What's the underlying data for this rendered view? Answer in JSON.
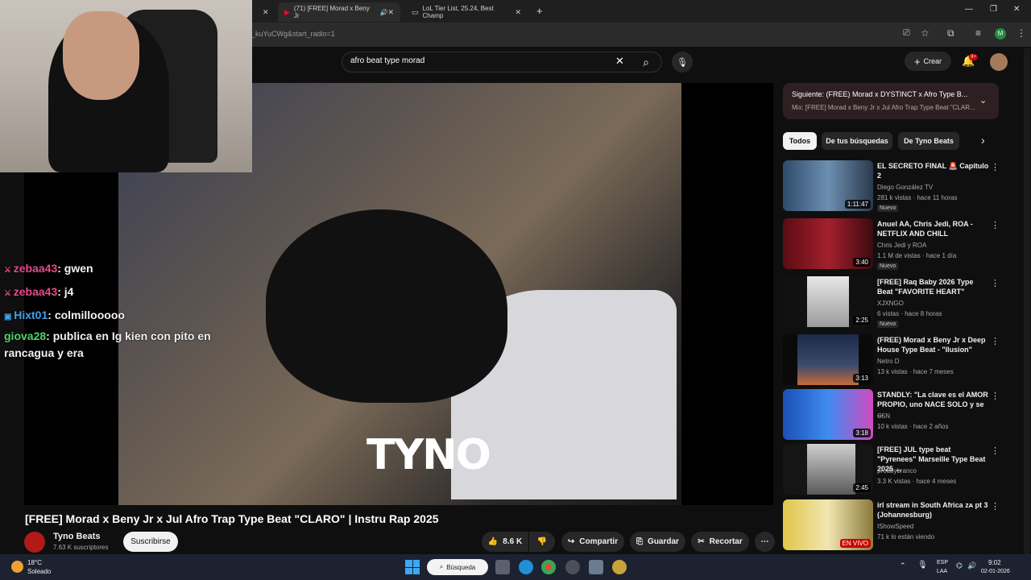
{
  "browser": {
    "tabs": [
      {
        "label": "(71) [FREE] Morad x Beny Jr"
      },
      {
        "label": "LoL Tier List, 25.24, Best Champ"
      }
    ],
    "new_tab": "+",
    "url": "_kuYuCWg&start_radio=1"
  },
  "header": {
    "search_query": "afro beat type morad",
    "create_label": "Crear",
    "notif_count": "9+"
  },
  "video": {
    "watermark": "TYNO",
    "title": "[FREE] Morad x Beny Jr x Jul Afro Trap Type Beat \"CLARO\" | Instru Rap 2025",
    "channel": "Tyno Beats",
    "subscribers": "7.63 K suscriptores",
    "subscribe_label": "Suscribirse",
    "likes": "8.6 K",
    "share_label": "Compartir",
    "save_label": "Guardar",
    "clip_label": "Recortar"
  },
  "chat": [
    {
      "user": "zebaa43",
      "text": ": gwen",
      "color": "#e54b8a"
    },
    {
      "user": "zebaa43",
      "text": ": j4",
      "color": "#e54b8a"
    },
    {
      "user": "Hixt01",
      "text": ": colmillooooo",
      "color": "#3fa3e8"
    },
    {
      "user": "giova28",
      "text": ": publica en Ig kien con pito en rancagua y era",
      "color": "#4fd36a"
    }
  ],
  "sidebar": {
    "next_title": "Siguiente: (FREE) Morad x DYSTINCT x Afro Type B...",
    "next_sub": "Mix: [FREE] Morad x Beny Jr x Jul Afro Trap Type Beat \"CLAR...",
    "chips": [
      "Todos",
      "De tus búsquedas",
      "De Tyno Beats"
    ],
    "recs": [
      {
        "title": "EL SECRETO FINAL 🚨 Capítulo 2",
        "channel": "Diego González TV",
        "meta": "281 k vistas · hace 11 horas",
        "badge": "Nuevo",
        "duration": "1:11:47",
        "color": "#4a6a8a"
      },
      {
        "title": "Anuel AA, Chris Jedi, ROA - NETFLIX AND CHILL",
        "channel": "Chris Jedi y ROA",
        "meta": "1.1 M de vistas · hace 1 día",
        "badge": "Nuevo",
        "duration": "3:40",
        "color": "#7a1a22"
      },
      {
        "title": "[FREE] Raq Baby 2026 Type Beat \"FAVORITE HEART\"",
        "channel": "XJXNGO",
        "meta": "6 vistas · hace 8 horas",
        "badge": "Nuevo",
        "duration": "2:25",
        "color": "#c8c8c8"
      },
      {
        "title": "(FREE) Morad x Beny Jr x Deep House Type Beat - \"Ilusion\"",
        "channel": "Netro D",
        "meta": "13 k vistas · hace 7 meses",
        "badge": "",
        "duration": "3:13",
        "color": "#1d2a44"
      },
      {
        "title": "STANDLY: \"La clave es el AMOR PROPIO, uno NACE SOLO y se ...",
        "channel": "C5N",
        "meta": "10 k vistas · hace 2 años",
        "badge": "",
        "duration": "3:18",
        "color": "#2a6fd6"
      },
      {
        "title": "[FREE] JUL type beat \"Pyrenees\" Marseille Type Beat 2025 ...",
        "channel": "prodbybranco",
        "meta": "3.3 K vistas · hace 4 meses",
        "badge": "",
        "duration": "2:45",
        "color": "#9aa0a6"
      },
      {
        "title": "irl stream in South Africa ᴢᴀ pt 3 (Johannesburg)",
        "channel": "IShowSpeed",
        "meta": "71 k lo están viendo",
        "badge": "",
        "duration": "EN VIVO",
        "color": "#d9b33a"
      }
    ]
  },
  "taskbar": {
    "temp": "18°C",
    "weather": "Soleado",
    "search_label": "Búsqueda",
    "lang1": "ESP",
    "lang2": "LAA",
    "time": "9:02",
    "date": "02-01-2026"
  }
}
